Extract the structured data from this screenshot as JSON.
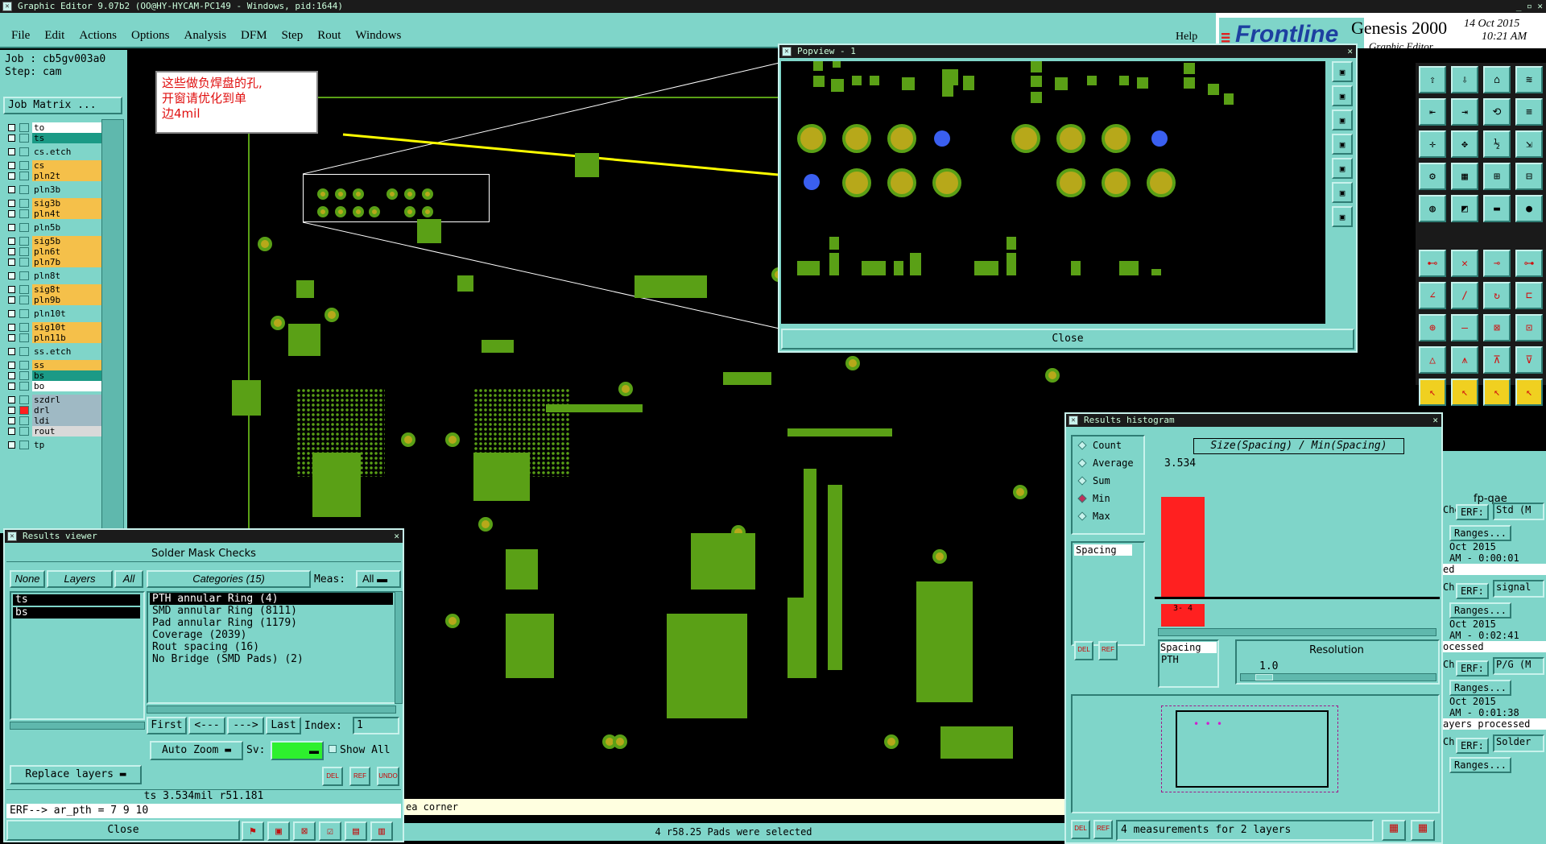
{
  "window": {
    "title": "Graphic Editor 9.07b2 (OO@HY-HYCAM-PC149 - Windows, pid:1644)"
  },
  "menu": [
    "File",
    "Edit",
    "Actions",
    "Options",
    "Analysis",
    "DFM",
    "Step",
    "Rout",
    "Windows"
  ],
  "help_label": "Help",
  "brand": {
    "logo": "Frontline",
    "product": "Genesis 2000",
    "subtitle": "Graphic Editor",
    "date": "14 Oct 2015",
    "time": "10:21 AM"
  },
  "job": {
    "job_label": "Job : cb5gv003a0",
    "step_label": "Step: cam",
    "matrix_button": "Job Matrix ..."
  },
  "layers": [
    {
      "name": "to",
      "color": "#ffffff"
    },
    {
      "name": "ts",
      "color": "#1b9a86"
    },
    {
      "name": "cs.etch",
      "color": "#7fd5c9"
    },
    {
      "name": "cs",
      "color": "#f5c04a"
    },
    {
      "name": "pln2t",
      "color": "#f5c04a"
    },
    {
      "name": "pln3b",
      "color": "#7fd5c9"
    },
    {
      "name": "sig3b",
      "color": "#f5c04a"
    },
    {
      "name": "pln4t",
      "color": "#f5c04a"
    },
    {
      "name": "pln5b",
      "color": "#7fd5c9"
    },
    {
      "name": "sig5b",
      "color": "#f5c04a"
    },
    {
      "name": "pln6t",
      "color": "#f5c04a"
    },
    {
      "name": "pln7b",
      "color": "#f5c04a"
    },
    {
      "name": "pln8t",
      "color": "#7fd5c9"
    },
    {
      "name": "sig8t",
      "color": "#f5c04a"
    },
    {
      "name": "pln9b",
      "color": "#f5c04a"
    },
    {
      "name": "pln10t",
      "color": "#7fd5c9"
    },
    {
      "name": "sig10t",
      "color": "#f5c04a"
    },
    {
      "name": "pln11b",
      "color": "#f5c04a"
    },
    {
      "name": "ss.etch",
      "color": "#7fd5c9"
    },
    {
      "name": "ss",
      "color": "#f5c04a"
    },
    {
      "name": "bs",
      "color": "#1b9a86"
    },
    {
      "name": "bo",
      "color": "#ffffff"
    },
    {
      "name": "szdrl",
      "color": "#9fb9c4"
    },
    {
      "name": "drl",
      "color": "#9fb9c4"
    },
    {
      "name": "ldi",
      "color": "#9fb9c4"
    },
    {
      "name": "rout",
      "color": "#d9d9d9"
    },
    {
      "name": "tp",
      "color": "#7fd5c9"
    }
  ],
  "annotation": {
    "line1": "这些做负焊盘的孔,",
    "line2": "开窗请优化到单",
    "line3": "边4mil"
  },
  "popview": {
    "title": "Popview - 1",
    "close_label": "Close"
  },
  "results_viewer": {
    "title": "Results viewer",
    "header": "Solder Mask Checks",
    "none_btn": "None",
    "layers_btn": "Layers",
    "all_btn": "All",
    "categories_label": "Categories (15)",
    "meas_label": "Meas:",
    "meas_value": "All",
    "layer_list": [
      "ts",
      "bs"
    ],
    "categories": [
      "PTH annular Ring (4)",
      "SMD annular Ring (8111)",
      "Pad annular Ring (1179)",
      "Coverage (2039)",
      "Rout spacing (16)",
      "No Bridge (SMD Pads) (2)"
    ],
    "first_btn": "First",
    "prev_btn": "<---",
    "next_btn": "--->",
    "last_btn": "Last",
    "index_label": "Index:",
    "index_value": "1",
    "auto_zoom": "Auto Zoom",
    "sv_label": "Sv:",
    "show_all": "Show All",
    "replace_layers": "Replace layers",
    "del_label": "DEL",
    "ref_label": "REF",
    "undo_label": "UNDO",
    "status": "ts 3.534mil   r51.181",
    "erf_line": "ERF--> ar_pth = 7 9 10",
    "close_label": "Close"
  },
  "histogram": {
    "title": "Results histogram",
    "options": [
      "Count",
      "Average",
      "Sum",
      "Min",
      "Max"
    ],
    "selected": "Min",
    "chart_title": "Size(Spacing) / Min(Spacing)",
    "bar_value": "3.534",
    "scale_label": "3-\n4",
    "list_item": "Spacing",
    "spacing_label": "Spacing",
    "pth_label": "PTH",
    "resolution_label": "Resolution",
    "resolution_value": "1.0",
    "summary": "4 measurements for 2 layers",
    "bar_color": "#ff2020"
  },
  "right_panel": {
    "title": "fp-qae",
    "erf_label": "ERF:",
    "std": "Std (M",
    "ranges": "Ranges...",
    "d1": "Oct 2015",
    "t1": "AM - 0:00:01",
    "s1": "ed",
    "signal": "signal",
    "d2": "Oct 2015",
    "t2": "AM - 0:02:41",
    "s2": "ocessed",
    "pg": "P/G (M",
    "d3": "Oct 2015",
    "t3": "AM - 0:01:38",
    "s3": "ayers processed",
    "solder": "Solder",
    "ch": "Ch",
    "che": "Che"
  },
  "status_bar": {
    "corner": "ea corner",
    "message": "4 r58.25 Pads were selected"
  }
}
